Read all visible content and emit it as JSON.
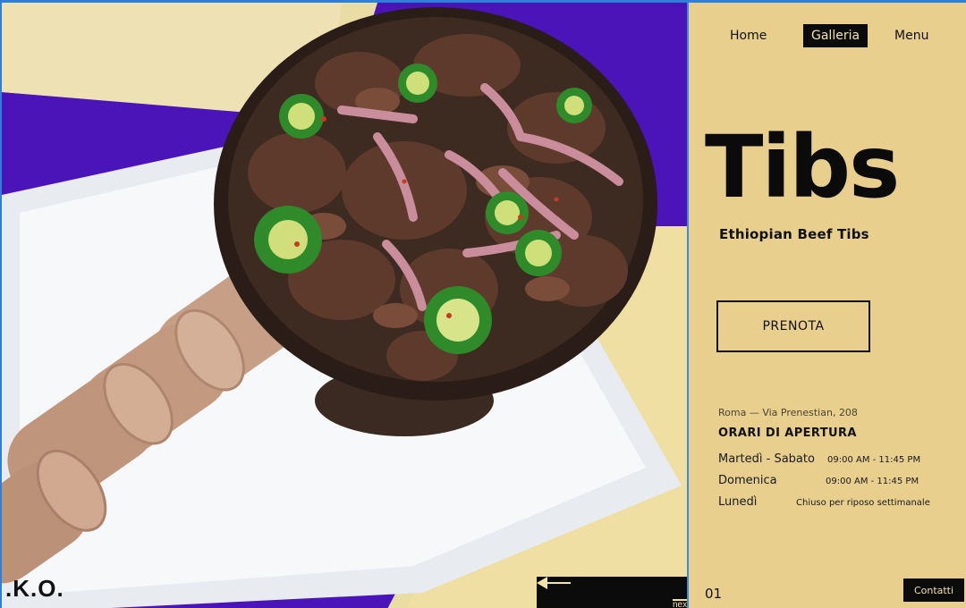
{
  "brand": {
    "logo_text": ".K.O."
  },
  "nav": {
    "home": "Home",
    "gallery": "Galleria",
    "menu": "Menu"
  },
  "dish": {
    "title": "Tibs",
    "subtitle": "Ethiopian Beef Tibs"
  },
  "reserve": {
    "label": "PRENOTA"
  },
  "info": {
    "address": "Roma — Via Prenestian, 208",
    "hours_title": "ORARI DI APERTURA",
    "hours": [
      {
        "day": "Martedì - Sabato",
        "time": "09:00 AM - 11:45 PM"
      },
      {
        "day": "Domenica",
        "time": "09:00 AM - 11:45 PM"
      },
      {
        "day": "Lunedì",
        "time": "Chiuso per riposo settimanale"
      }
    ]
  },
  "slider": {
    "next_label": "next",
    "page": "01"
  },
  "footer": {
    "contact": "Contatti"
  },
  "colors": {
    "panel_bg": "#e8cf8e",
    "accent_dark": "#0b0b0b",
    "accent_light": "#f3e2a2",
    "purple_cloth": "#4b14b8"
  },
  "icons": [
    "arrow-left-icon",
    "arrow-right-icon"
  ]
}
